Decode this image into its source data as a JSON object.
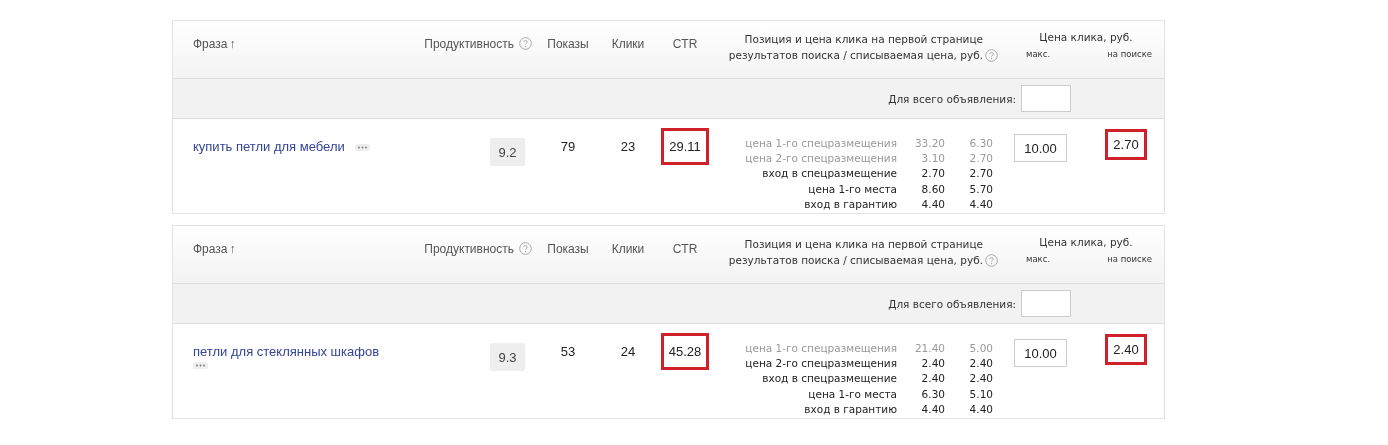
{
  "tables": [
    {
      "header": {
        "phrase": "Фраза",
        "sort_arrow": "↑",
        "productivity": "Продуктивность",
        "shows": "Показы",
        "clicks": "Клики",
        "ctr": "CTR",
        "position": "Позиция и цена клика на первой странице результатов поиска / списываемая цена, руб.",
        "price": "Цена клика, руб.",
        "price_max": "макс.",
        "price_search": "на поиске"
      },
      "filter": {
        "label": "Для всего объявления:"
      },
      "row": {
        "phrase": "купить петли для мебели",
        "phrase_wraps": false,
        "productivity": "9.2",
        "shows": "79",
        "clicks": "23",
        "ctr": "29.11",
        "ctr_highlighted": true,
        "positions": [
          {
            "label": "цена 1-го спецразмещения",
            "bid": "33.20",
            "charge": "6.30",
            "dimmed": true
          },
          {
            "label": "цена 2-го спецразмещения",
            "bid": "3.10",
            "charge": "2.70",
            "dimmed": true
          },
          {
            "label": "вход в спецразмещение",
            "bid": "2.70",
            "charge": "2.70",
            "dimmed": false
          },
          {
            "label": "цена 1-го места",
            "bid": "8.60",
            "charge": "5.70",
            "dimmed": false
          },
          {
            "label": "вход в гарантию",
            "bid": "4.40",
            "charge": "4.40",
            "dimmed": false
          }
        ],
        "max_price": "10.00",
        "search_price": "2.70",
        "search_highlighted": true
      }
    },
    {
      "header": {
        "phrase": "Фраза",
        "sort_arrow": "↑",
        "productivity": "Продуктивность",
        "shows": "Показы",
        "clicks": "Клики",
        "ctr": "CTR",
        "position": "Позиция и цена клика на первой странице результатов поиска / списываемая цена, руб.",
        "price": "Цена клика, руб.",
        "price_max": "макс.",
        "price_search": "на поиске"
      },
      "filter": {
        "label": "Для всего объявления:"
      },
      "row": {
        "phrase": "петли для стеклянных шкафов",
        "phrase_wraps": true,
        "productivity": "9.3",
        "shows": "53",
        "clicks": "24",
        "ctr": "45.28",
        "ctr_highlighted": true,
        "positions": [
          {
            "label": "цена 1-го спецразмещения",
            "bid": "21.40",
            "charge": "5.00",
            "dimmed": true
          },
          {
            "label": "цена 2-го спецразмещения",
            "bid": "2.40",
            "charge": "2.40",
            "dimmed": false
          },
          {
            "label": "вход в спецразмещение",
            "bid": "2.40",
            "charge": "2.40",
            "dimmed": false
          },
          {
            "label": "цена 1-го места",
            "bid": "6.30",
            "charge": "5.10",
            "dimmed": false
          },
          {
            "label": "вход в гарантию",
            "bid": "4.40",
            "charge": "4.40",
            "dimmed": false
          }
        ],
        "max_price": "10.00",
        "search_price": "2.40",
        "search_highlighted": true
      }
    }
  ]
}
